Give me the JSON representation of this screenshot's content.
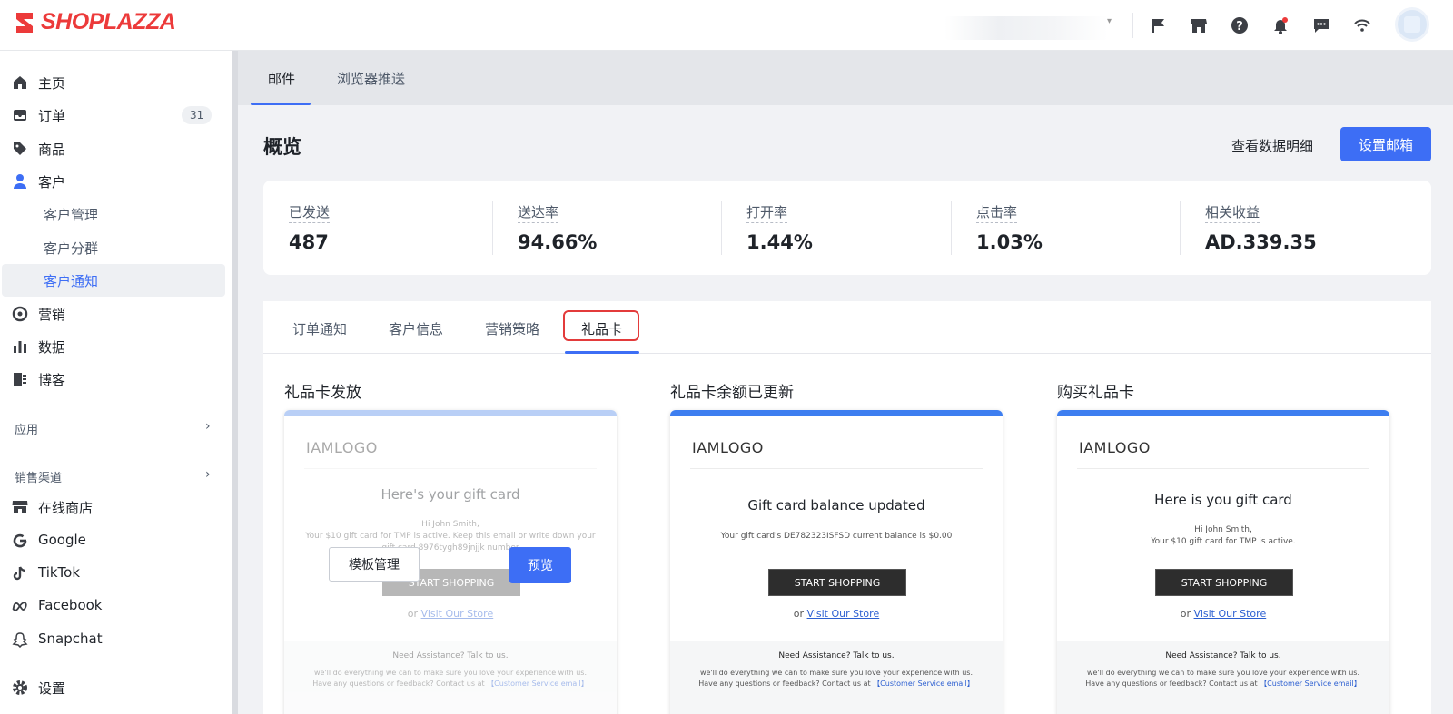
{
  "app": {
    "brand": "SHOPLAZZA"
  },
  "sidebar": {
    "items": [
      {
        "label": "主页",
        "icon": "home-icon"
      },
      {
        "label": "订单",
        "icon": "inbox-icon",
        "badge": "31"
      },
      {
        "label": "商品",
        "icon": "tag-icon"
      },
      {
        "label": "客户",
        "icon": "person-icon"
      },
      {
        "label": "客户管理"
      },
      {
        "label": "客户分群"
      },
      {
        "label": "客户通知",
        "active": true
      },
      {
        "label": "营销",
        "icon": "target-icon"
      },
      {
        "label": "数据",
        "icon": "bar-chart-icon"
      },
      {
        "label": "博客",
        "icon": "blog-icon"
      }
    ],
    "apps_section": "应用",
    "channels_section": "销售渠道",
    "channels": [
      {
        "label": "在线商店",
        "icon": "store-icon"
      },
      {
        "label": "Google",
        "icon": "google-icon"
      },
      {
        "label": "TikTok",
        "icon": "tiktok-icon"
      },
      {
        "label": "Facebook",
        "icon": "meta-icon"
      },
      {
        "label": "Snapchat",
        "icon": "snapchat-icon"
      }
    ],
    "settings": "设置"
  },
  "top_tabs": [
    "邮件",
    "浏览器推送"
  ],
  "page": {
    "title": "概览",
    "view_details": "查看数据明细",
    "setup_mailbox": "设置邮箱"
  },
  "stats": [
    {
      "label": "已发送",
      "value": "487"
    },
    {
      "label": "送达率",
      "value": "94.66%"
    },
    {
      "label": "打开率",
      "value": "1.44%"
    },
    {
      "label": "点击率",
      "value": "1.03%"
    },
    {
      "label": "相关收益",
      "value": "AD.339.35"
    }
  ],
  "content_tabs": [
    "订单通知",
    "客户信息",
    "营销策略",
    "礼品卡"
  ],
  "cards": [
    {
      "title": "礼品卡发放",
      "logo": "IAMLOGO",
      "heading": "Here's your gift card",
      "greeting": "Hi John Smith,",
      "body": "Your $10 gift card for TMP is active. Keep this email or write down your gift card 8976tygh89jnjjk number",
      "button": "START SHOPPING",
      "or": "or",
      "link": "Visit Our Store",
      "footer_head": "Need Assistance? Talk to us.",
      "footer_text": "we'll do everything we can to make sure you love your experience with us. Have any questions or feedback? Contact us at",
      "footer_link": "【Customer Service email】",
      "manage_template": "模板管理",
      "preview": "预览"
    },
    {
      "title": "礼品卡余额已更新",
      "logo": "IAMLOGO",
      "heading": "Gift card balance updated",
      "body": "Your gift card's DE782323ISFSD current balance is $0.00",
      "button": "START SHOPPING",
      "or": "or",
      "link": "Visit Our Store",
      "footer_head": "Need Assistance? Talk to us.",
      "footer_text": "we'll do everything we can to make sure you love your experience with us. Have any questions or feedback? Contact us at",
      "footer_link": "【Customer Service email】"
    },
    {
      "title": "购买礼品卡",
      "logo": "IAMLOGO",
      "heading": "Here is you gift card",
      "greeting": "Hi John Smith,",
      "body": "Your $10 gift card for TMP is active.",
      "button": "START SHOPPING",
      "or": "or",
      "link": "Visit Our Store",
      "footer_head": "Need Assistance? Talk to us.",
      "footer_text": "we'll do everything we can to make sure you love your experience with us. Have any questions or feedback? Contact us at",
      "footer_link": "【Customer Service email】"
    }
  ],
  "colors": {
    "accent": "#3d6ef5",
    "brand": "#ec3a3a",
    "highlight": "#e33b3b"
  }
}
